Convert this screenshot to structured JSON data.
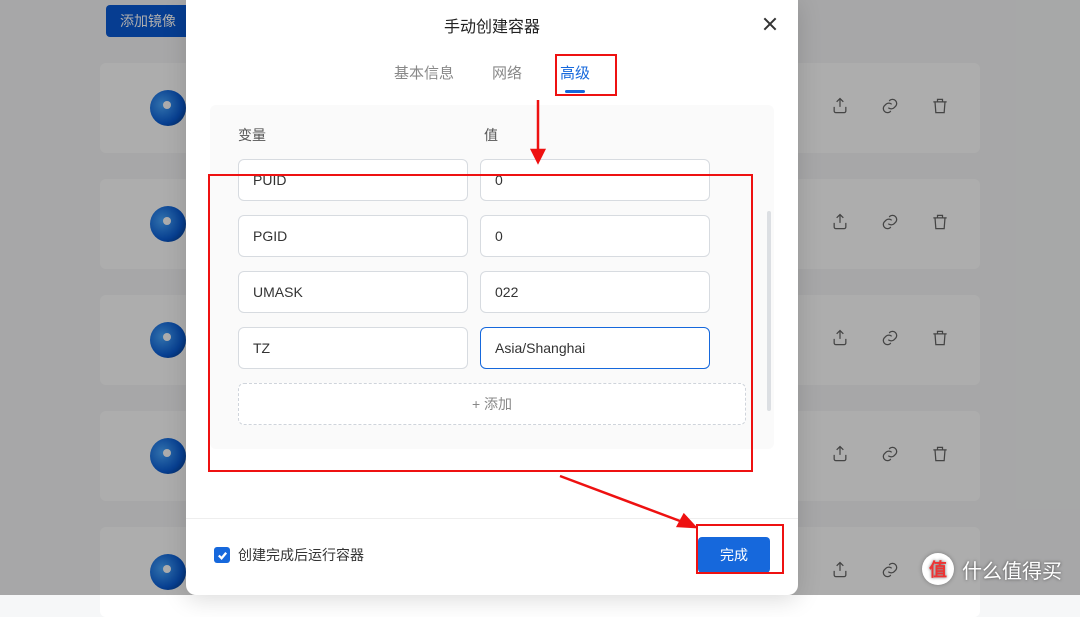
{
  "bg": {
    "add_image_button": "添加镜像"
  },
  "modal": {
    "title": "手动创建容器",
    "tabs": [
      "基本信息",
      "网络",
      "高级"
    ],
    "active_tab_index": 2,
    "columns": {
      "variable": "变量",
      "value": "值"
    },
    "rows": [
      {
        "var": "PUID",
        "val": "0"
      },
      {
        "var": "PGID",
        "val": "0"
      },
      {
        "var": "UMASK",
        "val": "022"
      },
      {
        "var": "TZ",
        "val": "Asia/Shanghai"
      }
    ],
    "add_label": "+ 添加",
    "run_after_create_label": "创建完成后运行容器",
    "run_after_create_checked": true,
    "finish_label": "完成"
  },
  "watermark": "什么值得买"
}
